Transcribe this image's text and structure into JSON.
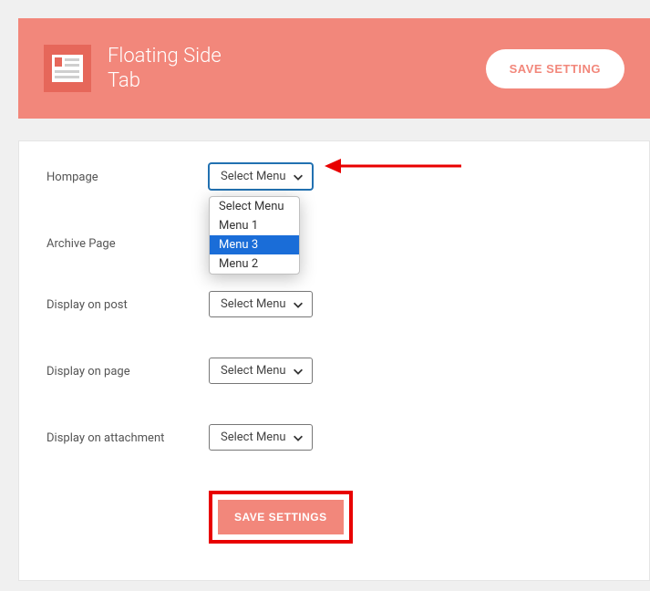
{
  "header": {
    "title_line1": "Floating Side",
    "title_line2": "Tab",
    "save_button": "SAVE SETTING"
  },
  "form": {
    "placeholder": "Select Menu",
    "rows": [
      {
        "label": "Hompage"
      },
      {
        "label": "Archive Page"
      },
      {
        "label": "Display on post"
      },
      {
        "label": "Display on page"
      },
      {
        "label": "Display on attachment"
      }
    ],
    "dropdown_options": [
      "Select Menu",
      "Menu 1",
      "Menu 3",
      "Menu 2"
    ],
    "highlighted_option": "Menu 3"
  },
  "footer": {
    "save_button": "SAVE SETTINGS"
  },
  "colors": {
    "accent": "#f2877b",
    "highlight": "#e80000",
    "dropdown_selected": "#1a6dd8"
  }
}
